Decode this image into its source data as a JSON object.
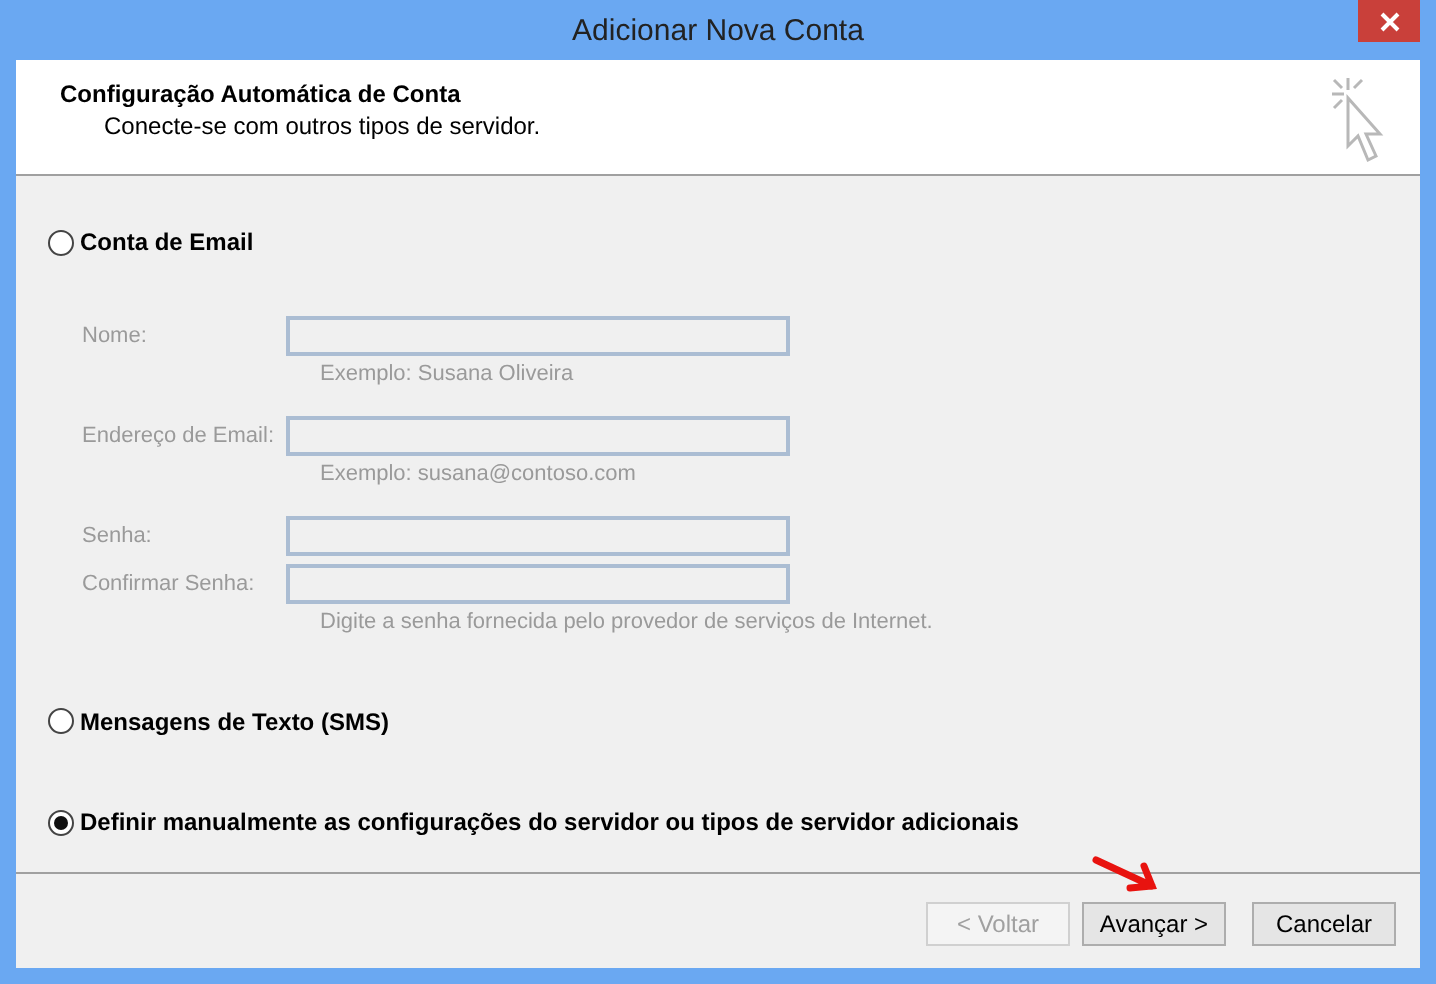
{
  "window": {
    "title": "Adicionar Nova Conta"
  },
  "header": {
    "title": "Configuração Automática de Conta",
    "subtitle": "Conecte-se com outros tipos de servidor."
  },
  "options": [
    {
      "label": "Conta de Email",
      "selected": false,
      "fields": [
        {
          "label": "Nome:",
          "hint": "Exemplo: Susana Oliveira",
          "disabled": true
        },
        {
          "label": "Endereço de Email:",
          "hint": "Exemplo: susana@contoso.com",
          "disabled": true
        },
        {
          "label": "Senha:",
          "disabled": true
        },
        {
          "label": "Confirmar Senha:",
          "hint": "Digite a senha fornecida pelo provedor de serviços de Internet.",
          "disabled": true
        }
      ]
    },
    {
      "label": "Mensagens de Texto (SMS)",
      "selected": false
    },
    {
      "label": "Definir manualmente as configurações do servidor ou tipos de servidor adicionais",
      "selected": true
    }
  ],
  "buttons": [
    {
      "label": "< Voltar",
      "disabled": true
    },
    {
      "label": "Avançar >",
      "disabled": false
    },
    {
      "label": "Cancelar",
      "disabled": false
    }
  ]
}
